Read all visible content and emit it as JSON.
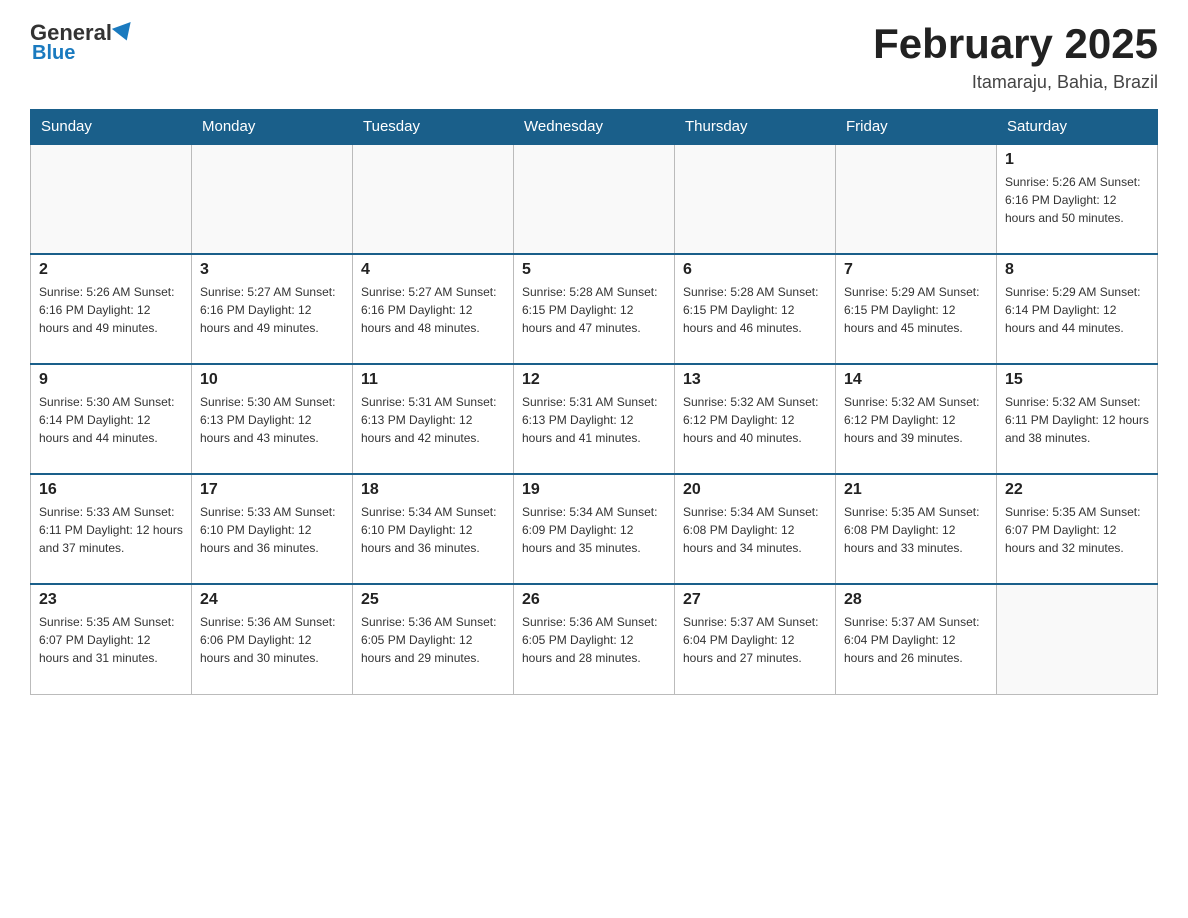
{
  "header": {
    "logo": {
      "general": "General",
      "blue": "Blue"
    },
    "title": "February 2025",
    "location": "Itamaraju, Bahia, Brazil"
  },
  "days_of_week": [
    "Sunday",
    "Monday",
    "Tuesday",
    "Wednesday",
    "Thursday",
    "Friday",
    "Saturday"
  ],
  "weeks": [
    [
      {
        "day": "",
        "info": ""
      },
      {
        "day": "",
        "info": ""
      },
      {
        "day": "",
        "info": ""
      },
      {
        "day": "",
        "info": ""
      },
      {
        "day": "",
        "info": ""
      },
      {
        "day": "",
        "info": ""
      },
      {
        "day": "1",
        "info": "Sunrise: 5:26 AM\nSunset: 6:16 PM\nDaylight: 12 hours and 50 minutes."
      }
    ],
    [
      {
        "day": "2",
        "info": "Sunrise: 5:26 AM\nSunset: 6:16 PM\nDaylight: 12 hours and 49 minutes."
      },
      {
        "day": "3",
        "info": "Sunrise: 5:27 AM\nSunset: 6:16 PM\nDaylight: 12 hours and 49 minutes."
      },
      {
        "day": "4",
        "info": "Sunrise: 5:27 AM\nSunset: 6:16 PM\nDaylight: 12 hours and 48 minutes."
      },
      {
        "day": "5",
        "info": "Sunrise: 5:28 AM\nSunset: 6:15 PM\nDaylight: 12 hours and 47 minutes."
      },
      {
        "day": "6",
        "info": "Sunrise: 5:28 AM\nSunset: 6:15 PM\nDaylight: 12 hours and 46 minutes."
      },
      {
        "day": "7",
        "info": "Sunrise: 5:29 AM\nSunset: 6:15 PM\nDaylight: 12 hours and 45 minutes."
      },
      {
        "day": "8",
        "info": "Sunrise: 5:29 AM\nSunset: 6:14 PM\nDaylight: 12 hours and 44 minutes."
      }
    ],
    [
      {
        "day": "9",
        "info": "Sunrise: 5:30 AM\nSunset: 6:14 PM\nDaylight: 12 hours and 44 minutes."
      },
      {
        "day": "10",
        "info": "Sunrise: 5:30 AM\nSunset: 6:13 PM\nDaylight: 12 hours and 43 minutes."
      },
      {
        "day": "11",
        "info": "Sunrise: 5:31 AM\nSunset: 6:13 PM\nDaylight: 12 hours and 42 minutes."
      },
      {
        "day": "12",
        "info": "Sunrise: 5:31 AM\nSunset: 6:13 PM\nDaylight: 12 hours and 41 minutes."
      },
      {
        "day": "13",
        "info": "Sunrise: 5:32 AM\nSunset: 6:12 PM\nDaylight: 12 hours and 40 minutes."
      },
      {
        "day": "14",
        "info": "Sunrise: 5:32 AM\nSunset: 6:12 PM\nDaylight: 12 hours and 39 minutes."
      },
      {
        "day": "15",
        "info": "Sunrise: 5:32 AM\nSunset: 6:11 PM\nDaylight: 12 hours and 38 minutes."
      }
    ],
    [
      {
        "day": "16",
        "info": "Sunrise: 5:33 AM\nSunset: 6:11 PM\nDaylight: 12 hours and 37 minutes."
      },
      {
        "day": "17",
        "info": "Sunrise: 5:33 AM\nSunset: 6:10 PM\nDaylight: 12 hours and 36 minutes."
      },
      {
        "day": "18",
        "info": "Sunrise: 5:34 AM\nSunset: 6:10 PM\nDaylight: 12 hours and 36 minutes."
      },
      {
        "day": "19",
        "info": "Sunrise: 5:34 AM\nSunset: 6:09 PM\nDaylight: 12 hours and 35 minutes."
      },
      {
        "day": "20",
        "info": "Sunrise: 5:34 AM\nSunset: 6:08 PM\nDaylight: 12 hours and 34 minutes."
      },
      {
        "day": "21",
        "info": "Sunrise: 5:35 AM\nSunset: 6:08 PM\nDaylight: 12 hours and 33 minutes."
      },
      {
        "day": "22",
        "info": "Sunrise: 5:35 AM\nSunset: 6:07 PM\nDaylight: 12 hours and 32 minutes."
      }
    ],
    [
      {
        "day": "23",
        "info": "Sunrise: 5:35 AM\nSunset: 6:07 PM\nDaylight: 12 hours and 31 minutes."
      },
      {
        "day": "24",
        "info": "Sunrise: 5:36 AM\nSunset: 6:06 PM\nDaylight: 12 hours and 30 minutes."
      },
      {
        "day": "25",
        "info": "Sunrise: 5:36 AM\nSunset: 6:05 PM\nDaylight: 12 hours and 29 minutes."
      },
      {
        "day": "26",
        "info": "Sunrise: 5:36 AM\nSunset: 6:05 PM\nDaylight: 12 hours and 28 minutes."
      },
      {
        "day": "27",
        "info": "Sunrise: 5:37 AM\nSunset: 6:04 PM\nDaylight: 12 hours and 27 minutes."
      },
      {
        "day": "28",
        "info": "Sunrise: 5:37 AM\nSunset: 6:04 PM\nDaylight: 12 hours and 26 minutes."
      },
      {
        "day": "",
        "info": ""
      }
    ]
  ]
}
